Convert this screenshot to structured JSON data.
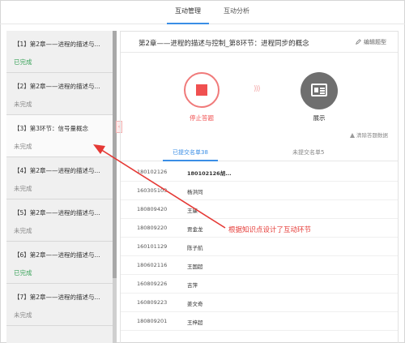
{
  "topnav": {
    "tabs": [
      {
        "label": "互动管理"
      },
      {
        "label": "互动分析"
      }
    ]
  },
  "sidebar": {
    "items": [
      {
        "title": "【1】第2章——进程的描述与...",
        "status": "已完成",
        "done": true
      },
      {
        "title": "【2】第2章——进程的描述与...",
        "status": "未完成",
        "done": false
      },
      {
        "title": "【3】第3环节：信号量概念",
        "status": "未完成",
        "done": false
      },
      {
        "title": "【4】第2章——进程的描述与...",
        "status": "未完成",
        "done": false
      },
      {
        "title": "【5】第2章——进程的描述与...",
        "status": "未完成",
        "done": false
      },
      {
        "title": "【6】第2章——进程的描述与...",
        "status": "已完成",
        "done": true
      },
      {
        "title": "【7】第2章——进程的描述与...",
        "status": "未完成",
        "done": false
      }
    ]
  },
  "main": {
    "title": "第2章——进程的描述与控制_第8环节：进程同步的概念",
    "edit_label": "编辑题型",
    "stop_label": "停止答题",
    "waves": ")))",
    "show_label": "展示",
    "clear_label": "清除答题数据",
    "subtabs": [
      {
        "label": "已提交名单38"
      },
      {
        "label": "未提交名单5"
      }
    ],
    "rows": [
      {
        "id": "180102126",
        "name": "180102126胡..."
      },
      {
        "id": "160305103",
        "name": "杨洪同"
      },
      {
        "id": "180809420",
        "name": "王康"
      },
      {
        "id": "180809220",
        "name": "贾金龙"
      },
      {
        "id": "160101129",
        "name": "陈子航"
      },
      {
        "id": "180602116",
        "name": "王国超"
      },
      {
        "id": "160809226",
        "name": "吉萍"
      },
      {
        "id": "160809223",
        "name": "姜文奇"
      },
      {
        "id": "180809201",
        "name": "王梓超"
      }
    ]
  },
  "annotation": {
    "text": "根据知识点设计了互动环节",
    "color": "#e53935"
  },
  "colors": {
    "accent": "#3a8ee6",
    "stop": "#f05050",
    "done": "#3aa35a"
  }
}
